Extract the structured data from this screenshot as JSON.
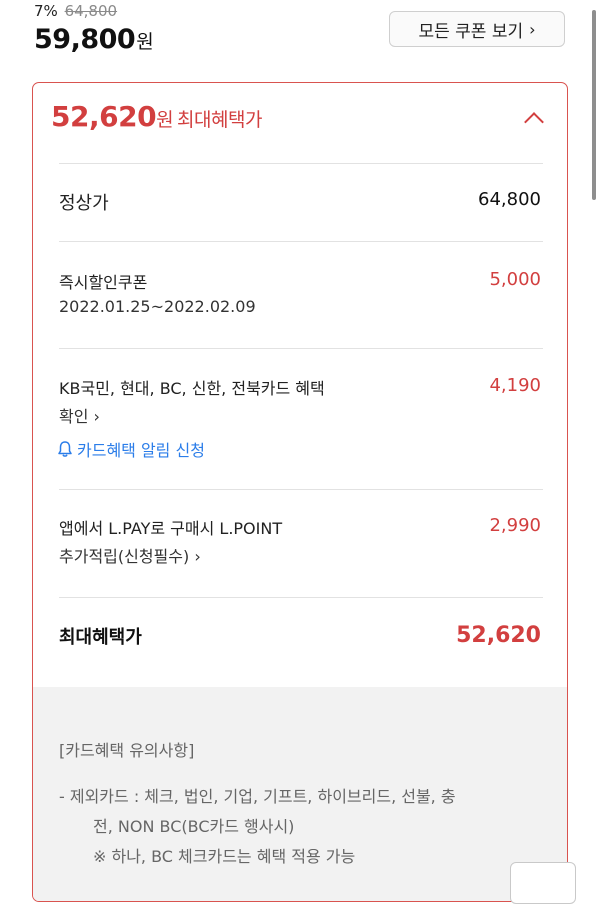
{
  "price_header": {
    "discount_rate": "7%",
    "original_price": "64,800",
    "sale_price": "59,800",
    "currency_unit": "원",
    "coupon_button_label": "모든 쿠폰 보기"
  },
  "benefit_card": {
    "max_price": "52,620",
    "max_price_unit": "원",
    "max_price_label": "최대혜택가",
    "rows": {
      "regular": {
        "label": "정상가",
        "value": "64,800"
      },
      "instant_coupon": {
        "label": "즉시할인쿠폰",
        "period": "2022.01.25~2022.02.09",
        "value": "5,000"
      },
      "card": {
        "label": "KB국민, 현대, BC, 신한, 전북카드 혜택",
        "sub_label": "확인",
        "alert_label": "카드혜택 알림 신청",
        "value": "4,190"
      },
      "lpay": {
        "label": "앱에서 L.PAY로 구매시 L.POINT",
        "sub_label": "추가적립(신청필수)",
        "value": "2,990"
      }
    },
    "total": {
      "label": "최대혜택가",
      "value": "52,620"
    }
  },
  "card_notice": {
    "title": "[카드혜택 유의사항]",
    "lines": [
      "- 제외카드 : 체크, 법인, 기업, 기프트, 하이브리드, 선불, 충",
      "전, NON BC(BC카드 행사시)",
      "※ 하나, BC 체크카드는 혜택 적용 가능"
    ]
  },
  "colors": {
    "accent_red": "#d23f3f",
    "link_blue": "#2b7de9",
    "border_red": "#d9534f"
  }
}
